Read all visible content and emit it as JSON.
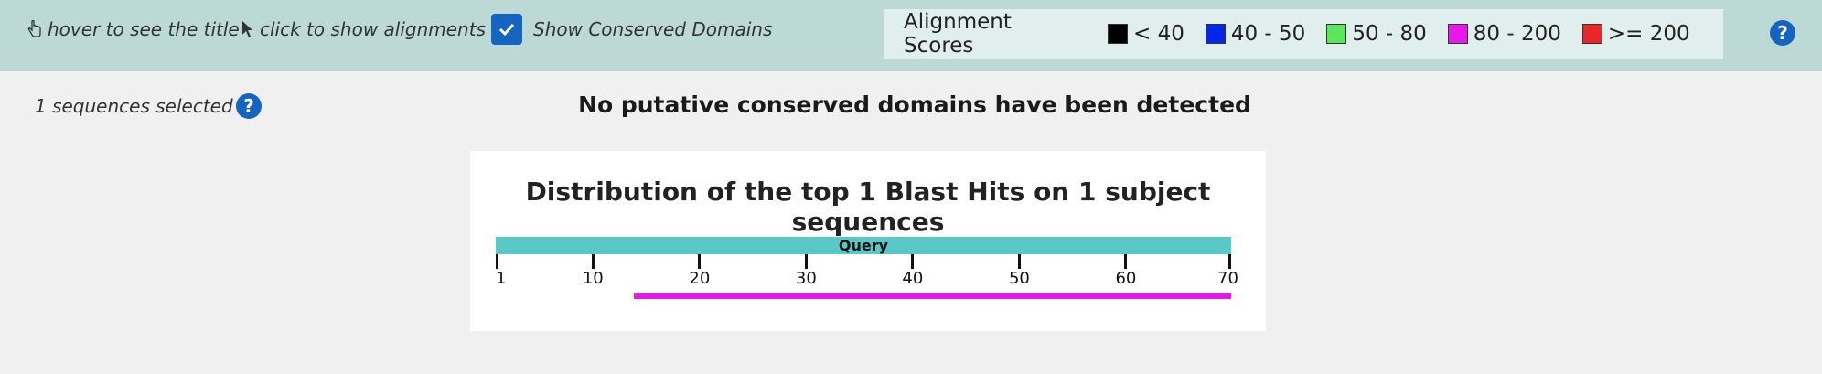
{
  "toolbar": {
    "hover_hint": "hover to see the title",
    "click_hint": "click to show alignments",
    "conserved_domains_label": "Show Conserved Domains",
    "conserved_domains_checked": true
  },
  "legend": {
    "title": "Alignment Scores",
    "items": [
      {
        "label": "< 40",
        "color": "#000000"
      },
      {
        "label": "40 - 50",
        "color": "#0028e6"
      },
      {
        "label": "50 - 80",
        "color": "#5ce65c"
      },
      {
        "label": "80 - 200",
        "color": "#e619e6"
      },
      {
        "label": ">= 200",
        "color": "#e62828"
      }
    ]
  },
  "help_icon_text": "?",
  "sequences_selected": "1 sequences selected",
  "conserved_message": "No putative conserved domains have been detected",
  "graphic": {
    "title": "Distribution of the top 1 Blast Hits on 1 subject sequences",
    "query_label": "Query",
    "query_length": 70,
    "ticks": [
      "1",
      "10",
      "20",
      "30",
      "40",
      "50",
      "60",
      "70"
    ],
    "tick_values": [
      1,
      10,
      20,
      30,
      40,
      50,
      60,
      70
    ],
    "hits": [
      {
        "start": 14,
        "end": 70,
        "score_color": "#e619e6"
      }
    ]
  },
  "colors": {
    "toolbar_bg": "#bcd9d6",
    "legend_bg": "#e0eeed",
    "query_bar": "#5bc8c8",
    "accent": "#1565c0"
  }
}
